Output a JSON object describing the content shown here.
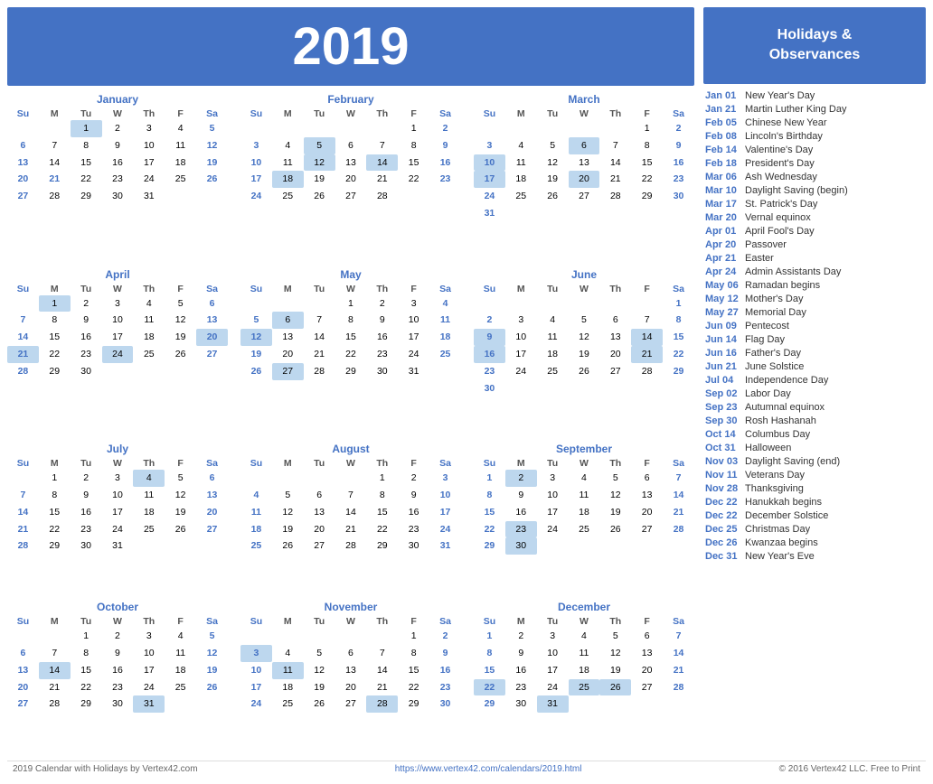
{
  "year": "2019",
  "calendar_title": "2019",
  "holidays_header": "Holidays &\nObservances",
  "footer": {
    "left": "2019 Calendar with Holidays by Vertex42.com",
    "center": "https://www.vertex42.com/calendars/2019.html",
    "right": "© 2016 Vertex42 LLC. Free to Print"
  },
  "months": [
    {
      "name": "January",
      "days": [
        {
          "week": [
            null,
            null,
            1,
            2,
            3,
            4,
            5
          ]
        },
        {
          "week": [
            6,
            7,
            8,
            9,
            10,
            11,
            12
          ]
        },
        {
          "week": [
            13,
            14,
            15,
            16,
            17,
            18,
            19
          ]
        },
        {
          "week": [
            20,
            21,
            22,
            23,
            24,
            25,
            26
          ]
        },
        {
          "week": [
            27,
            28,
            29,
            30,
            31,
            null,
            null
          ]
        }
      ],
      "highlights": [
        1
      ],
      "blue_sun": [
        21
      ],
      "blue_sat": [
        5,
        12,
        19,
        26
      ]
    },
    {
      "name": "February",
      "days": [
        {
          "week": [
            null,
            null,
            null,
            null,
            null,
            1,
            2
          ]
        },
        {
          "week": [
            3,
            4,
            5,
            6,
            7,
            8,
            9
          ]
        },
        {
          "week": [
            10,
            11,
            12,
            13,
            14,
            15,
            16
          ]
        },
        {
          "week": [
            17,
            18,
            19,
            20,
            21,
            22,
            23
          ]
        },
        {
          "week": [
            24,
            25,
            26,
            27,
            28,
            null,
            null
          ]
        }
      ],
      "highlights": [
        5,
        12,
        14,
        18
      ],
      "blue_sat": [
        2,
        9,
        16,
        23
      ],
      "blue_sun": []
    },
    {
      "name": "March",
      "days": [
        {
          "week": [
            null,
            null,
            null,
            null,
            null,
            1,
            2
          ]
        },
        {
          "week": [
            3,
            4,
            5,
            6,
            7,
            8,
            9
          ]
        },
        {
          "week": [
            10,
            11,
            12,
            13,
            14,
            15,
            16
          ]
        },
        {
          "week": [
            17,
            18,
            19,
            20,
            21,
            22,
            23
          ]
        },
        {
          "week": [
            24,
            25,
            26,
            27,
            28,
            29,
            30
          ]
        },
        {
          "week": [
            31,
            null,
            null,
            null,
            null,
            null,
            null
          ]
        }
      ],
      "highlights": [
        6,
        10,
        17,
        20
      ],
      "blue_sat": [
        2,
        9,
        16,
        23,
        30
      ],
      "blue_sun": []
    },
    {
      "name": "April",
      "days": [
        {
          "week": [
            null,
            1,
            2,
            3,
            4,
            5,
            6
          ]
        },
        {
          "week": [
            7,
            8,
            9,
            10,
            11,
            12,
            13
          ]
        },
        {
          "week": [
            14,
            15,
            16,
            17,
            18,
            19,
            20
          ]
        },
        {
          "week": [
            21,
            22,
            23,
            24,
            25,
            26,
            27
          ]
        },
        {
          "week": [
            28,
            29,
            30,
            null,
            null,
            null,
            null
          ]
        }
      ],
      "highlights": [
        1,
        20,
        21,
        24
      ],
      "blue_sat": [
        6,
        13,
        20,
        27
      ],
      "blue_sun": []
    },
    {
      "name": "May",
      "days": [
        {
          "week": [
            null,
            null,
            null,
            1,
            2,
            3,
            4
          ]
        },
        {
          "week": [
            5,
            6,
            7,
            8,
            9,
            10,
            11
          ]
        },
        {
          "week": [
            12,
            13,
            14,
            15,
            16,
            17,
            18
          ]
        },
        {
          "week": [
            19,
            20,
            21,
            22,
            23,
            24,
            25
          ]
        },
        {
          "week": [
            26,
            27,
            28,
            29,
            30,
            31,
            null
          ]
        }
      ],
      "highlights": [
        6,
        12,
        27
      ],
      "blue_sat": [
        4,
        11,
        18,
        25
      ],
      "blue_sun": []
    },
    {
      "name": "June",
      "days": [
        {
          "week": [
            null,
            null,
            null,
            null,
            null,
            null,
            1
          ]
        },
        {
          "week": [
            2,
            3,
            4,
            5,
            6,
            7,
            8
          ]
        },
        {
          "week": [
            9,
            10,
            11,
            12,
            13,
            14,
            15
          ]
        },
        {
          "week": [
            16,
            17,
            18,
            19,
            20,
            21,
            22
          ]
        },
        {
          "week": [
            23,
            24,
            25,
            26,
            27,
            28,
            29
          ]
        },
        {
          "week": [
            30,
            null,
            null,
            null,
            null,
            null,
            null
          ]
        }
      ],
      "highlights": [
        9,
        14,
        16,
        21
      ],
      "blue_sat": [
        1,
        8,
        15,
        22,
        29
      ],
      "blue_sun": []
    },
    {
      "name": "July",
      "days": [
        {
          "week": [
            null,
            1,
            2,
            3,
            4,
            5,
            6
          ]
        },
        {
          "week": [
            7,
            8,
            9,
            10,
            11,
            12,
            13
          ]
        },
        {
          "week": [
            14,
            15,
            16,
            17,
            18,
            19,
            20
          ]
        },
        {
          "week": [
            21,
            22,
            23,
            24,
            25,
            26,
            27
          ]
        },
        {
          "week": [
            28,
            29,
            30,
            31,
            null,
            null,
            null
          ]
        }
      ],
      "highlights": [
        4
      ],
      "blue_sat": [
        6,
        13,
        20,
        27
      ],
      "blue_sun": []
    },
    {
      "name": "August",
      "days": [
        {
          "week": [
            null,
            null,
            null,
            null,
            1,
            2,
            3
          ]
        },
        {
          "week": [
            4,
            5,
            6,
            7,
            8,
            9,
            10
          ]
        },
        {
          "week": [
            11,
            12,
            13,
            14,
            15,
            16,
            17
          ]
        },
        {
          "week": [
            18,
            19,
            20,
            21,
            22,
            23,
            24
          ]
        },
        {
          "week": [
            25,
            26,
            27,
            28,
            29,
            30,
            31
          ]
        }
      ],
      "highlights": [],
      "blue_sat": [
        3,
        10,
        17,
        24,
        31
      ],
      "blue_sun": []
    },
    {
      "name": "September",
      "days": [
        {
          "week": [
            1,
            2,
            3,
            4,
            5,
            6,
            7
          ]
        },
        {
          "week": [
            8,
            9,
            10,
            11,
            12,
            13,
            14
          ]
        },
        {
          "week": [
            15,
            16,
            17,
            18,
            19,
            20,
            21
          ]
        },
        {
          "week": [
            22,
            23,
            24,
            25,
            26,
            27,
            28
          ]
        },
        {
          "week": [
            29,
            30,
            null,
            null,
            null,
            null,
            null
          ]
        }
      ],
      "highlights": [
        2,
        23,
        30
      ],
      "blue_sat": [
        7,
        14,
        21,
        28
      ],
      "blue_sun": []
    },
    {
      "name": "October",
      "days": [
        {
          "week": [
            null,
            null,
            1,
            2,
            3,
            4,
            5
          ]
        },
        {
          "week": [
            6,
            7,
            8,
            9,
            10,
            11,
            12
          ]
        },
        {
          "week": [
            13,
            14,
            15,
            16,
            17,
            18,
            19
          ]
        },
        {
          "week": [
            20,
            21,
            22,
            23,
            24,
            25,
            26
          ]
        },
        {
          "week": [
            27,
            28,
            29,
            30,
            31,
            null,
            null
          ]
        }
      ],
      "highlights": [
        14,
        31
      ],
      "blue_sat": [
        5,
        12,
        19,
        26
      ],
      "blue_sun": []
    },
    {
      "name": "November",
      "days": [
        {
          "week": [
            null,
            null,
            null,
            null,
            null,
            1,
            2
          ]
        },
        {
          "week": [
            3,
            4,
            5,
            6,
            7,
            8,
            9
          ]
        },
        {
          "week": [
            10,
            11,
            12,
            13,
            14,
            15,
            16
          ]
        },
        {
          "week": [
            17,
            18,
            19,
            20,
            21,
            22,
            23
          ]
        },
        {
          "week": [
            24,
            25,
            26,
            27,
            28,
            29,
            30
          ]
        }
      ],
      "highlights": [
        3,
        11,
        28
      ],
      "blue_sat": [
        2,
        9,
        16,
        23,
        30
      ],
      "blue_sun": []
    },
    {
      "name": "December",
      "days": [
        {
          "week": [
            1,
            2,
            3,
            4,
            5,
            6,
            7
          ]
        },
        {
          "week": [
            8,
            9,
            10,
            11,
            12,
            13,
            14
          ]
        },
        {
          "week": [
            15,
            16,
            17,
            18,
            19,
            20,
            21
          ]
        },
        {
          "week": [
            22,
            23,
            24,
            25,
            26,
            27,
            28
          ]
        },
        {
          "week": [
            29,
            30,
            31,
            null,
            null,
            null,
            null
          ]
        }
      ],
      "highlights": [
        22,
        25,
        26,
        31
      ],
      "blue_sat": [
        7,
        14,
        21,
        28
      ],
      "blue_sun": []
    }
  ],
  "holidays": [
    {
      "date": "Jan 01",
      "name": "New Year's Day"
    },
    {
      "date": "Jan 21",
      "name": "Martin Luther King Day"
    },
    {
      "date": "Feb 05",
      "name": "Chinese New Year"
    },
    {
      "date": "Feb 08",
      "name": "Lincoln's Birthday"
    },
    {
      "date": "Feb 14",
      "name": "Valentine's Day"
    },
    {
      "date": "Feb 18",
      "name": "President's Day"
    },
    {
      "date": "Mar 06",
      "name": "Ash Wednesday"
    },
    {
      "date": "Mar 10",
      "name": "Daylight Saving (begin)"
    },
    {
      "date": "Mar 17",
      "name": "St. Patrick's Day"
    },
    {
      "date": "Mar 20",
      "name": "Vernal equinox"
    },
    {
      "date": "Apr 01",
      "name": "April Fool's Day"
    },
    {
      "date": "Apr 20",
      "name": "Passover"
    },
    {
      "date": "Apr 21",
      "name": "Easter"
    },
    {
      "date": "Apr 24",
      "name": "Admin Assistants Day"
    },
    {
      "date": "May 06",
      "name": "Ramadan begins"
    },
    {
      "date": "May 12",
      "name": "Mother's Day"
    },
    {
      "date": "May 27",
      "name": "Memorial Day"
    },
    {
      "date": "Jun 09",
      "name": "Pentecost"
    },
    {
      "date": "Jun 14",
      "name": "Flag Day"
    },
    {
      "date": "Jun 16",
      "name": "Father's Day"
    },
    {
      "date": "Jun 21",
      "name": "June Solstice"
    },
    {
      "date": "Jul 04",
      "name": "Independence Day"
    },
    {
      "date": "Sep 02",
      "name": "Labor Day"
    },
    {
      "date": "Sep 23",
      "name": "Autumnal equinox"
    },
    {
      "date": "Sep 30",
      "name": "Rosh Hashanah"
    },
    {
      "date": "Oct 14",
      "name": "Columbus Day"
    },
    {
      "date": "Oct 31",
      "name": "Halloween"
    },
    {
      "date": "Nov 03",
      "name": "Daylight Saving (end)"
    },
    {
      "date": "Nov 11",
      "name": "Veterans Day"
    },
    {
      "date": "Nov 28",
      "name": "Thanksgiving"
    },
    {
      "date": "Dec 22",
      "name": "Hanukkah begins"
    },
    {
      "date": "Dec 22",
      "name": "December Solstice"
    },
    {
      "date": "Dec 25",
      "name": "Christmas Day"
    },
    {
      "date": "Dec 26",
      "name": "Kwanzaa begins"
    },
    {
      "date": "Dec 31",
      "name": "New Year's Eve"
    }
  ],
  "weekdays": [
    "Su",
    "M",
    "Tu",
    "W",
    "Th",
    "F",
    "Sa"
  ]
}
